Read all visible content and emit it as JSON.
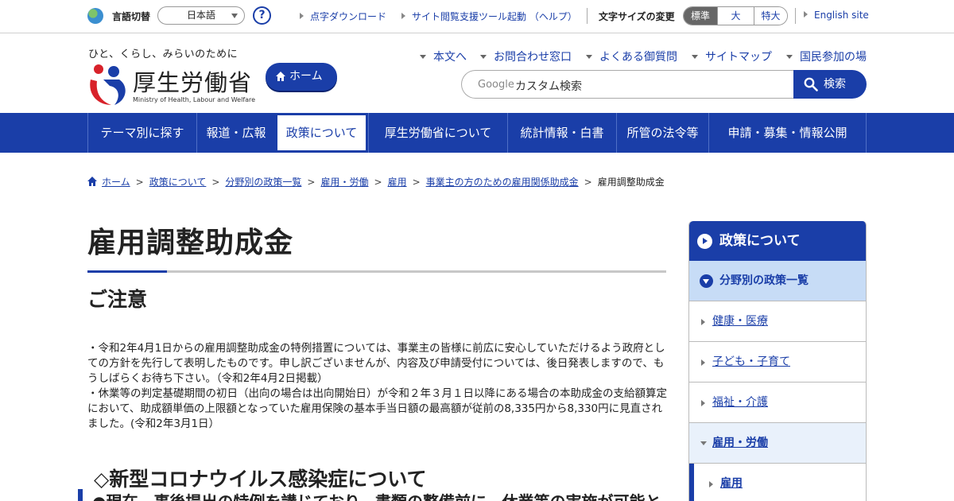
{
  "util": {
    "lang_label": "言語切替",
    "lang_value": "日本語",
    "help": "?",
    "links": [
      "点字ダウンロード",
      "サイト閲覧支援ツール起動 （ヘルプ）"
    ],
    "fontsize_label": "文字サイズの変更",
    "fontsizes": [
      "標準",
      "大",
      "特大"
    ],
    "english": "English site"
  },
  "header": {
    "tagline": "ひと、くらし、みらいのために",
    "ministry_name": "厚生労働省",
    "ministry_en": "Ministry of Health, Labour and Welfare",
    "home_label": "ホーム",
    "links": [
      "本文へ",
      "お問合わせ窓口",
      "よくある御質問",
      "サイトマップ",
      "国民参加の場"
    ],
    "search_brand": "Google",
    "search_placeholder": "カスタム検索",
    "search_button": "検索"
  },
  "gnav": {
    "items": [
      "テーマ別に探す",
      "報道・広報",
      "政策について",
      "厚生労働省について",
      "統計情報・白書",
      "所管の法令等",
      "申請・募集・情報公開"
    ],
    "active_index": 2
  },
  "breadcrumb": {
    "items": [
      "ホーム",
      "政策について",
      "分野別の政策一覧",
      "雇用・労働",
      "雇用",
      "事業主の方のための雇用関係助成金"
    ],
    "current": "雇用調整助成金",
    "separator": ">"
  },
  "main": {
    "title": "雇用調整助成金",
    "notice_heading": "ご注意",
    "notice_lines": [
      "・令和2年4月1日からの雇用調整助成金の特例措置については、事業主の皆様に前広に安心していただけるよう政府としての方針を先行して表明したものです。申し訳ございませんが、内容及び申請受付については、後日発表しますので、もうしばらくお待ち下さい。（令和2年4月2日掲載）",
      "・休業等の判定基礎期間の初日（出向の場合は出向開始日）が令和２年３月１日以降にある場合の本助成金の支給額算定において、助成額単価の上限額となっていた雇用保険の基本手当日額の最高額が従前の8,335円から8,330円に見直されました。(令和2年3月1日）"
    ],
    "covid_heading": "◇新型コロナウイルス感染症について",
    "covid_bullet": "●現在、事後提出の特例を講じており、書類の整備前に、休業等の実施が可能と"
  },
  "side": {
    "heading": "政策について",
    "sub": "分野別の政策一覧",
    "items": [
      "健康・医療",
      "子ども・子育て",
      "福祉・介護",
      "雇用・労働",
      "雇用"
    ]
  },
  "colors": {
    "brand_blue": "#1a3ea8",
    "sidebar_highlight": "#c7dcf6"
  }
}
